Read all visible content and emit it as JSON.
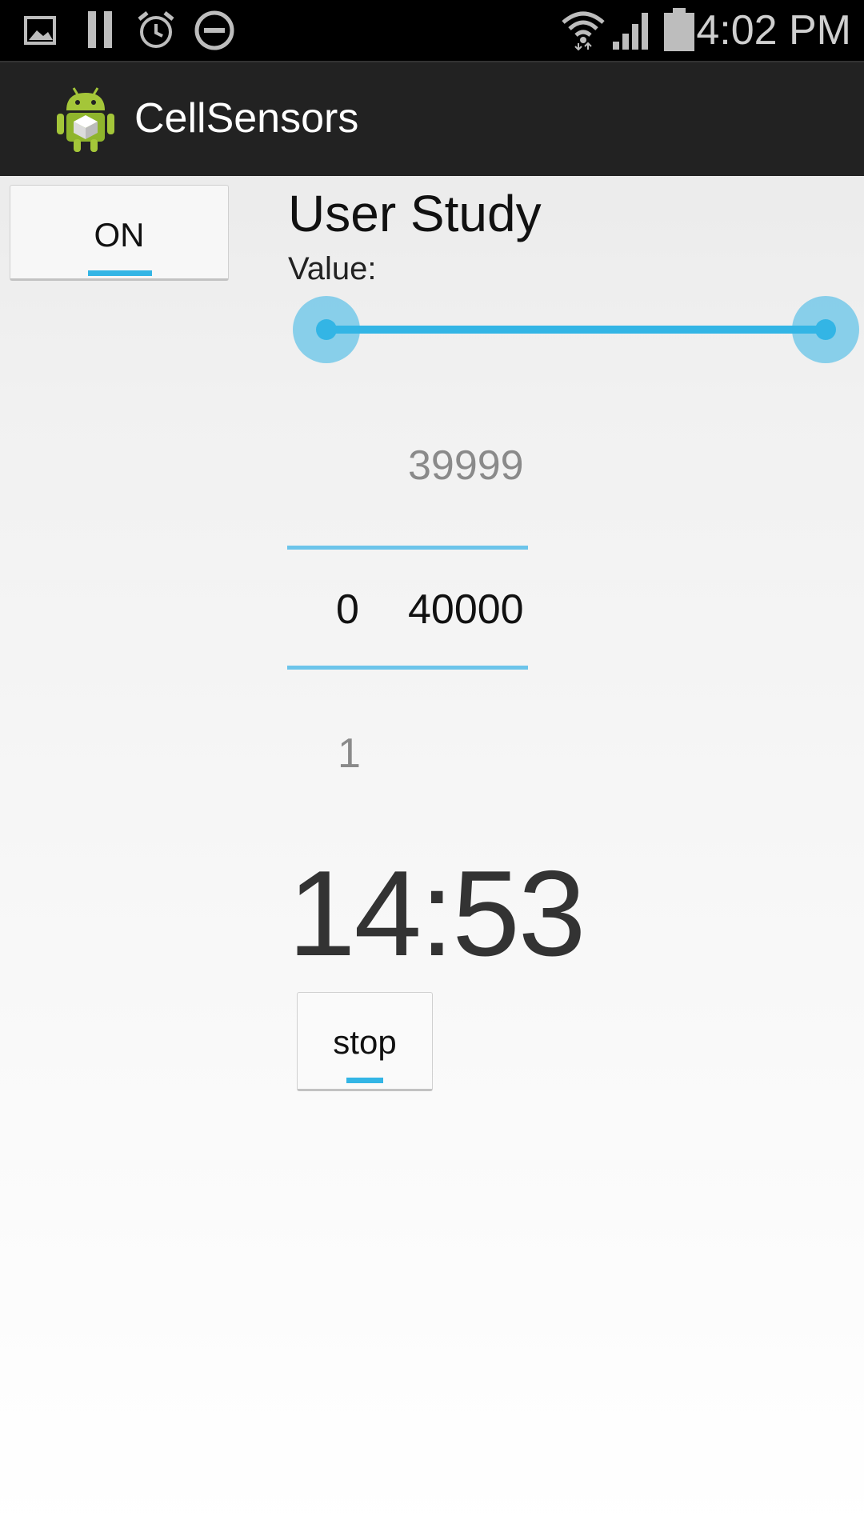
{
  "status_bar": {
    "time": "4:02 PM",
    "icons": [
      "gallery-icon",
      "pause-icon",
      "alarm-icon",
      "do-not-disturb-icon",
      "wifi-icon",
      "signal-icon",
      "battery-icon"
    ]
  },
  "action_bar": {
    "title": "CellSensors",
    "icon": "android-app-icon"
  },
  "toggle": {
    "label": "ON",
    "state": "on"
  },
  "study": {
    "title": "User Study",
    "value_label": "Value:"
  },
  "range_slider": {
    "min_fraction": 0.0,
    "max_fraction": 1.0,
    "accent": "#33b5e5"
  },
  "picker": {
    "left_column": {
      "current": "0",
      "next": "1"
    },
    "right_column": {
      "previous": "39999",
      "current": "40000"
    }
  },
  "timer": {
    "value": "14:53"
  },
  "stop_button": {
    "label": "stop"
  },
  "colors": {
    "accent": "#33b5e5",
    "action_bar": "#222222",
    "status_bar": "#000000"
  }
}
